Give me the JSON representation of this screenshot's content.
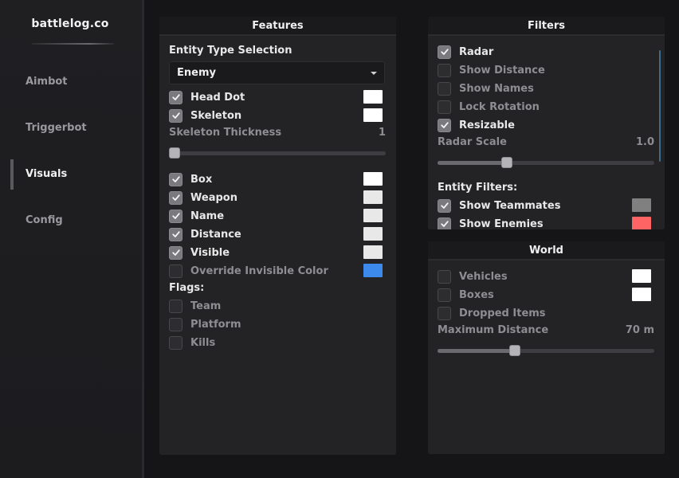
{
  "app": {
    "brand": "battlelog.co"
  },
  "sidebar": {
    "items": [
      {
        "label": "Aimbot",
        "active": false
      },
      {
        "label": "Triggerbot",
        "active": false
      },
      {
        "label": "Visuals",
        "active": true
      },
      {
        "label": "Config",
        "active": false
      }
    ]
  },
  "features": {
    "title": "Features",
    "entity_type_label": "Entity Type Selection",
    "entity_type_value": "Enemy",
    "head_dot": {
      "label": "Head Dot",
      "checked": true,
      "color": "#ffffff"
    },
    "skeleton": {
      "label": "Skeleton",
      "checked": true,
      "color": "#ffffff"
    },
    "skeleton_thickness": {
      "label": "Skeleton Thickness",
      "value": "1",
      "fraction": 0.0
    },
    "box": {
      "label": "Box",
      "checked": true,
      "color": "#ffffff"
    },
    "weapon": {
      "label": "Weapon",
      "checked": true,
      "color": "#e8e8e8"
    },
    "name": {
      "label": "Name",
      "checked": true,
      "color": "#e8e8e8"
    },
    "distance": {
      "label": "Distance",
      "checked": true,
      "color": "#e8e8e8"
    },
    "visible": {
      "label": "Visible",
      "checked": true,
      "color": "#e8e8e8"
    },
    "override_invisible": {
      "label": "Override Invisible Color",
      "checked": false,
      "color": "#3d8aed"
    },
    "flags_label": "Flags:",
    "flags": [
      {
        "label": "Team",
        "checked": false
      },
      {
        "label": "Platform",
        "checked": false
      },
      {
        "label": "Kills",
        "checked": false
      }
    ]
  },
  "filters": {
    "title": "Filters",
    "radar": {
      "label": "Radar",
      "checked": true
    },
    "show_distance": {
      "label": "Show Distance",
      "checked": false
    },
    "show_names": {
      "label": "Show Names",
      "checked": false
    },
    "lock_rotation": {
      "label": "Lock Rotation",
      "checked": false
    },
    "resizable": {
      "label": "Resizable",
      "checked": true
    },
    "radar_scale": {
      "label": "Radar Scale",
      "value": "1.0",
      "fraction": 0.31
    },
    "entity_filters_label": "Entity Filters:",
    "show_teammates": {
      "label": "Show Teammates",
      "checked": true,
      "color": "#808080"
    },
    "show_enemies": {
      "label": "Show Enemies",
      "checked": true,
      "color": "#ff6464"
    }
  },
  "world": {
    "title": "World",
    "vehicles": {
      "label": "Vehicles",
      "checked": false,
      "color": "#ffffff"
    },
    "boxes": {
      "label": "Boxes",
      "checked": false,
      "color": "#ffffff"
    },
    "dropped_items": {
      "label": "Dropped Items",
      "checked": false
    },
    "max_distance": {
      "label": "Maximum Distance",
      "value": "70 m",
      "fraction": 0.35
    }
  }
}
